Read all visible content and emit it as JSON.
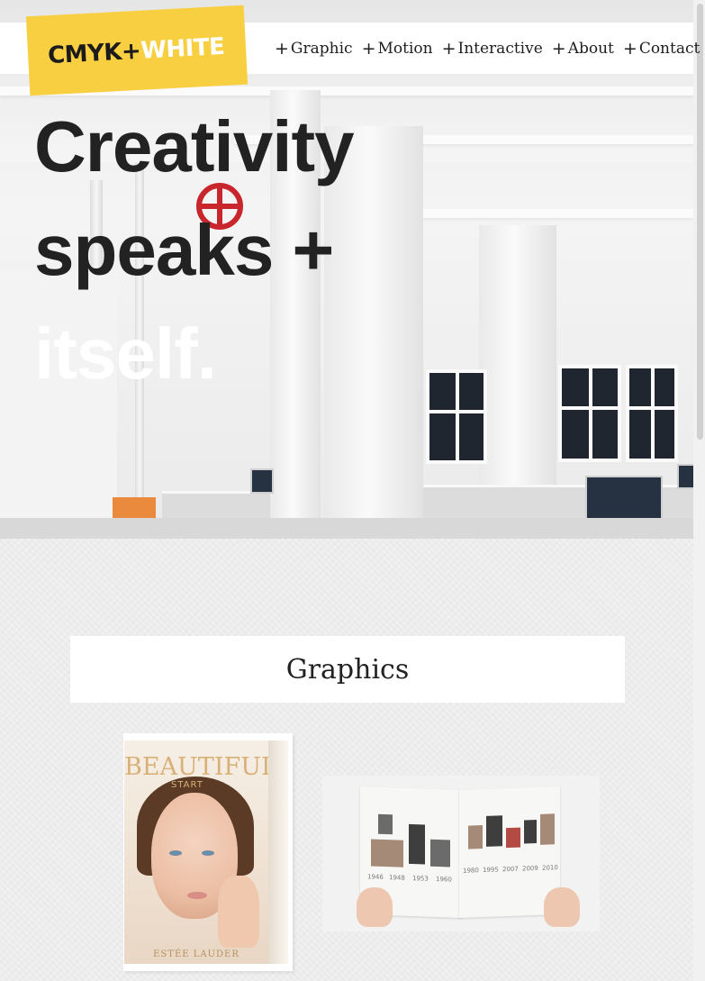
{
  "header": {
    "logo": {
      "part1": "CMYK",
      "plus": "+",
      "part2": "WHITE"
    },
    "nav": [
      {
        "prefix": "+",
        "label": "Graphic"
      },
      {
        "prefix": "+",
        "label": "Motion"
      },
      {
        "prefix": "+",
        "label": "Interactive"
      },
      {
        "prefix": "+",
        "label": "About"
      },
      {
        "prefix": "+",
        "label": "Contact"
      }
    ]
  },
  "hero": {
    "line1": "Creativity",
    "line2": "speaks +",
    "line3": "itself."
  },
  "graphics": {
    "title": "Graphics",
    "items": [
      {
        "cover_title": "BEAUTIFUL",
        "cover_subtitle": "START",
        "cover_brand": "ESTÉE LAUDER"
      },
      {
        "year_labels": [
          "1946",
          "1948",
          "1953",
          "1960",
          "1980",
          "1995",
          "2007",
          "2009",
          "2010"
        ]
      }
    ]
  },
  "colors": {
    "logo_bg": "#f9cf42",
    "headline_dark": "#222222",
    "headline_light": "#ffffff",
    "section_bg": "#f0f0f0"
  }
}
